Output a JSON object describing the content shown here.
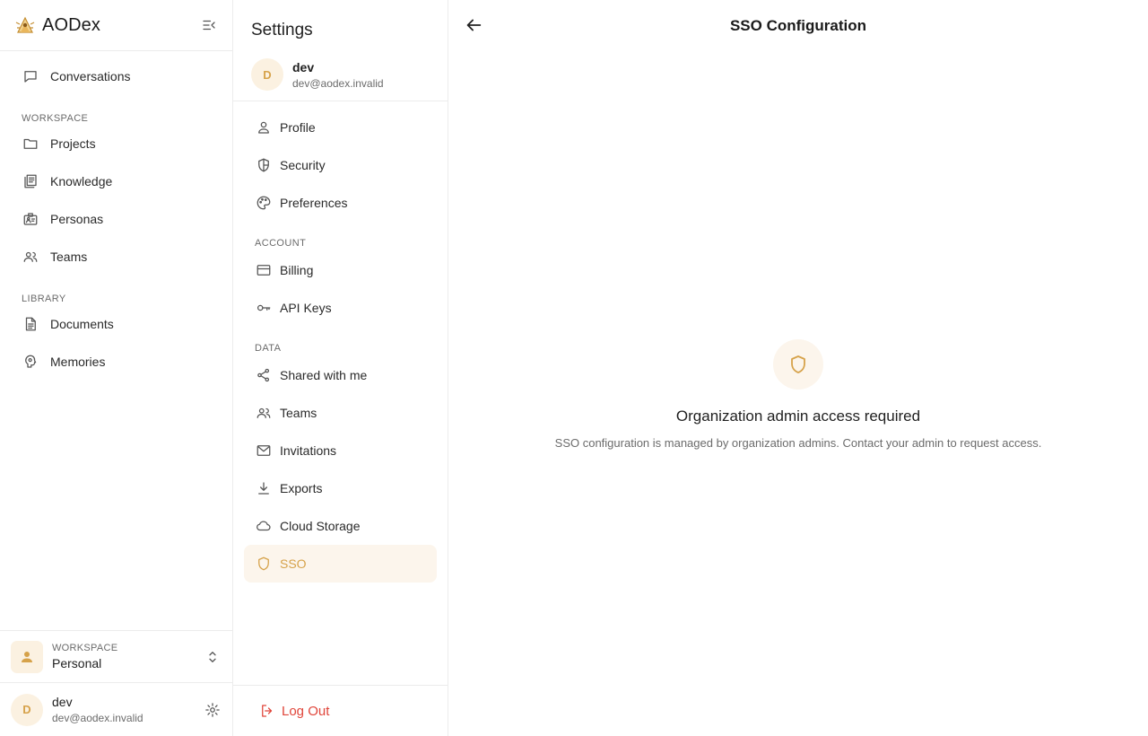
{
  "app": {
    "name": "AODex"
  },
  "sidebar": {
    "conversations": "Conversations",
    "workspace_section": "WORKSPACE",
    "workspace_items": [
      {
        "label": "Projects",
        "icon": "folder-icon"
      },
      {
        "label": "Knowledge",
        "icon": "library-icon"
      },
      {
        "label": "Personas",
        "icon": "id-badge-icon"
      },
      {
        "label": "Teams",
        "icon": "users-icon"
      }
    ],
    "library_section": "LIBRARY",
    "library_items": [
      {
        "label": "Documents",
        "icon": "document-icon"
      },
      {
        "label": "Memories",
        "icon": "brain-icon"
      }
    ]
  },
  "workspace_switcher": {
    "label": "WORKSPACE",
    "value": "Personal"
  },
  "user": {
    "initial": "D",
    "name": "dev",
    "email": "dev@aodex.invalid"
  },
  "settings": {
    "title": "Settings",
    "items": [
      {
        "label": "Profile",
        "icon": "person-icon"
      },
      {
        "label": "Security",
        "icon": "shield-icon"
      },
      {
        "label": "Preferences",
        "icon": "palette-icon"
      }
    ],
    "account_section": "ACCOUNT",
    "account_items": [
      {
        "label": "Billing",
        "icon": "credit-card-icon"
      },
      {
        "label": "API Keys",
        "icon": "key-icon"
      }
    ],
    "data_section": "DATA",
    "data_items": [
      {
        "label": "Shared with me",
        "icon": "share-icon"
      },
      {
        "label": "Teams",
        "icon": "users-icon"
      },
      {
        "label": "Invitations",
        "icon": "mail-icon"
      },
      {
        "label": "Exports",
        "icon": "download-icon"
      },
      {
        "label": "Cloud Storage",
        "icon": "cloud-icon"
      },
      {
        "label": "SSO",
        "icon": "shield-outline-icon",
        "active": true
      }
    ],
    "logout": "Log Out"
  },
  "main": {
    "title": "SSO Configuration",
    "empty_title": "Organization admin access required",
    "empty_description": "SSO configuration is managed by organization admins. Contact your admin to request access."
  },
  "colors": {
    "accent": "#d6a24a",
    "accent_bg": "#fcf5ec",
    "danger": "#e0453a"
  }
}
